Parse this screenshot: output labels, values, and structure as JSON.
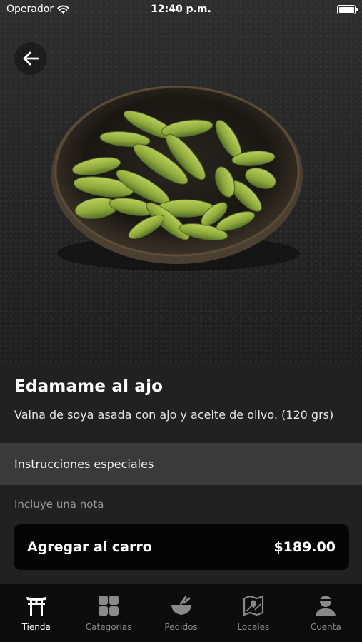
{
  "status_bar": {
    "carrier": "Operador",
    "time": "12:40 p.m."
  },
  "product": {
    "name": "Edamame al ajo",
    "description": "Vaina de soya asada con ajo y aceite de olivo. (120 grs)"
  },
  "special_instructions": {
    "header": "Instrucciones especiales",
    "note_placeholder": "Incluye una nota"
  },
  "cart_button": {
    "label": "Agregar al carro",
    "price": "$189.00"
  },
  "tab_bar": {
    "items": [
      {
        "label": "Tienda",
        "icon": "torii-gate-icon",
        "active": true
      },
      {
        "label": "Categorías",
        "icon": "grid-icon",
        "active": false
      },
      {
        "label": "Pedidos",
        "icon": "bowl-icon",
        "active": false
      },
      {
        "label": "Locales",
        "icon": "map-icon",
        "active": false
      },
      {
        "label": "Cuenta",
        "icon": "user-icon",
        "active": false
      }
    ]
  }
}
